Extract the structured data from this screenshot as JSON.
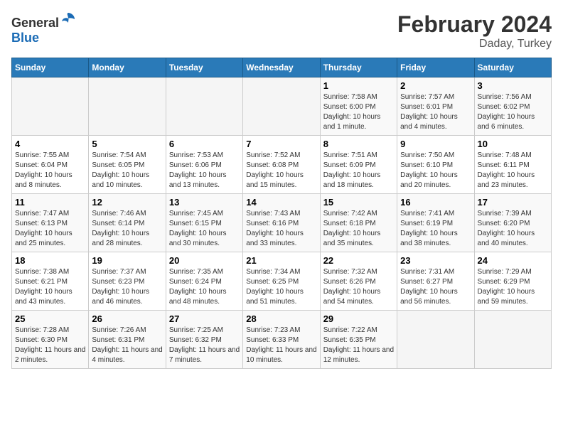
{
  "header": {
    "logo_general": "General",
    "logo_blue": "Blue",
    "title": "February 2024",
    "subtitle": "Daday, Turkey"
  },
  "days_of_week": [
    "Sunday",
    "Monday",
    "Tuesday",
    "Wednesday",
    "Thursday",
    "Friday",
    "Saturday"
  ],
  "weeks": [
    [
      {
        "day": "",
        "info": ""
      },
      {
        "day": "",
        "info": ""
      },
      {
        "day": "",
        "info": ""
      },
      {
        "day": "",
        "info": ""
      },
      {
        "day": "1",
        "info": "Sunrise: 7:58 AM\nSunset: 6:00 PM\nDaylight: 10 hours and 1 minute."
      },
      {
        "day": "2",
        "info": "Sunrise: 7:57 AM\nSunset: 6:01 PM\nDaylight: 10 hours and 4 minutes."
      },
      {
        "day": "3",
        "info": "Sunrise: 7:56 AM\nSunset: 6:02 PM\nDaylight: 10 hours and 6 minutes."
      }
    ],
    [
      {
        "day": "4",
        "info": "Sunrise: 7:55 AM\nSunset: 6:04 PM\nDaylight: 10 hours and 8 minutes."
      },
      {
        "day": "5",
        "info": "Sunrise: 7:54 AM\nSunset: 6:05 PM\nDaylight: 10 hours and 10 minutes."
      },
      {
        "day": "6",
        "info": "Sunrise: 7:53 AM\nSunset: 6:06 PM\nDaylight: 10 hours and 13 minutes."
      },
      {
        "day": "7",
        "info": "Sunrise: 7:52 AM\nSunset: 6:08 PM\nDaylight: 10 hours and 15 minutes."
      },
      {
        "day": "8",
        "info": "Sunrise: 7:51 AM\nSunset: 6:09 PM\nDaylight: 10 hours and 18 minutes."
      },
      {
        "day": "9",
        "info": "Sunrise: 7:50 AM\nSunset: 6:10 PM\nDaylight: 10 hours and 20 minutes."
      },
      {
        "day": "10",
        "info": "Sunrise: 7:48 AM\nSunset: 6:11 PM\nDaylight: 10 hours and 23 minutes."
      }
    ],
    [
      {
        "day": "11",
        "info": "Sunrise: 7:47 AM\nSunset: 6:13 PM\nDaylight: 10 hours and 25 minutes."
      },
      {
        "day": "12",
        "info": "Sunrise: 7:46 AM\nSunset: 6:14 PM\nDaylight: 10 hours and 28 minutes."
      },
      {
        "day": "13",
        "info": "Sunrise: 7:45 AM\nSunset: 6:15 PM\nDaylight: 10 hours and 30 minutes."
      },
      {
        "day": "14",
        "info": "Sunrise: 7:43 AM\nSunset: 6:16 PM\nDaylight: 10 hours and 33 minutes."
      },
      {
        "day": "15",
        "info": "Sunrise: 7:42 AM\nSunset: 6:18 PM\nDaylight: 10 hours and 35 minutes."
      },
      {
        "day": "16",
        "info": "Sunrise: 7:41 AM\nSunset: 6:19 PM\nDaylight: 10 hours and 38 minutes."
      },
      {
        "day": "17",
        "info": "Sunrise: 7:39 AM\nSunset: 6:20 PM\nDaylight: 10 hours and 40 minutes."
      }
    ],
    [
      {
        "day": "18",
        "info": "Sunrise: 7:38 AM\nSunset: 6:21 PM\nDaylight: 10 hours and 43 minutes."
      },
      {
        "day": "19",
        "info": "Sunrise: 7:37 AM\nSunset: 6:23 PM\nDaylight: 10 hours and 46 minutes."
      },
      {
        "day": "20",
        "info": "Sunrise: 7:35 AM\nSunset: 6:24 PM\nDaylight: 10 hours and 48 minutes."
      },
      {
        "day": "21",
        "info": "Sunrise: 7:34 AM\nSunset: 6:25 PM\nDaylight: 10 hours and 51 minutes."
      },
      {
        "day": "22",
        "info": "Sunrise: 7:32 AM\nSunset: 6:26 PM\nDaylight: 10 hours and 54 minutes."
      },
      {
        "day": "23",
        "info": "Sunrise: 7:31 AM\nSunset: 6:27 PM\nDaylight: 10 hours and 56 minutes."
      },
      {
        "day": "24",
        "info": "Sunrise: 7:29 AM\nSunset: 6:29 PM\nDaylight: 10 hours and 59 minutes."
      }
    ],
    [
      {
        "day": "25",
        "info": "Sunrise: 7:28 AM\nSunset: 6:30 PM\nDaylight: 11 hours and 2 minutes."
      },
      {
        "day": "26",
        "info": "Sunrise: 7:26 AM\nSunset: 6:31 PM\nDaylight: 11 hours and 4 minutes."
      },
      {
        "day": "27",
        "info": "Sunrise: 7:25 AM\nSunset: 6:32 PM\nDaylight: 11 hours and 7 minutes."
      },
      {
        "day": "28",
        "info": "Sunrise: 7:23 AM\nSunset: 6:33 PM\nDaylight: 11 hours and 10 minutes."
      },
      {
        "day": "29",
        "info": "Sunrise: 7:22 AM\nSunset: 6:35 PM\nDaylight: 11 hours and 12 minutes."
      },
      {
        "day": "",
        "info": ""
      },
      {
        "day": "",
        "info": ""
      }
    ]
  ]
}
